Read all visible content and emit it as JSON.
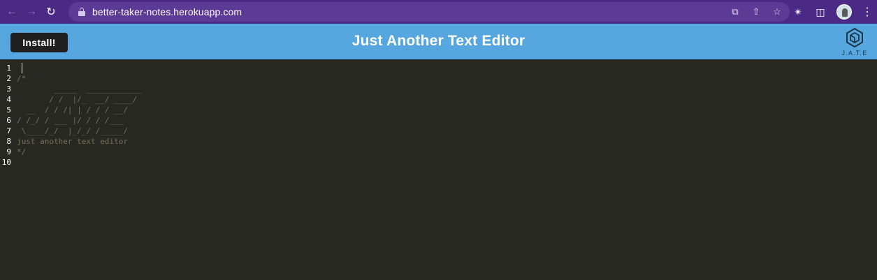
{
  "browser": {
    "url": "better-taker-notes.herokuapp.com",
    "icons": {
      "back": "arrow-left-icon",
      "forward": "arrow-right-icon",
      "reload": "reload-icon",
      "lock": "lock-icon",
      "open_in_app": "open-external-icon",
      "share": "share-icon",
      "bookmark": "star-icon",
      "extensions": "puzzle-icon",
      "sidebar": "sidebar-icon",
      "profile": "avatar",
      "menu": "more-vertical-icon"
    }
  },
  "header": {
    "install_label": "Install!",
    "title": "Just Another Text Editor",
    "logo_text": "J.A.T.E",
    "background": "#56a6e0"
  },
  "editor": {
    "line_numbers": [
      "1",
      "2",
      "3",
      "4",
      "5",
      "6",
      "7",
      "8",
      "9",
      "10"
    ],
    "lines": [
      "",
      "/*",
      "        _____  ____________",
      "       / /  |/_  __/ ____/",
      "  __  / / /| | / / / __/",
      "/ /_/ / ___ |/ / / /___",
      " \\____/_/  |_/_/ /_____/",
      "just another text editor",
      "*/",
      ""
    ],
    "background": "#272822",
    "comment_color": "#75715e"
  }
}
